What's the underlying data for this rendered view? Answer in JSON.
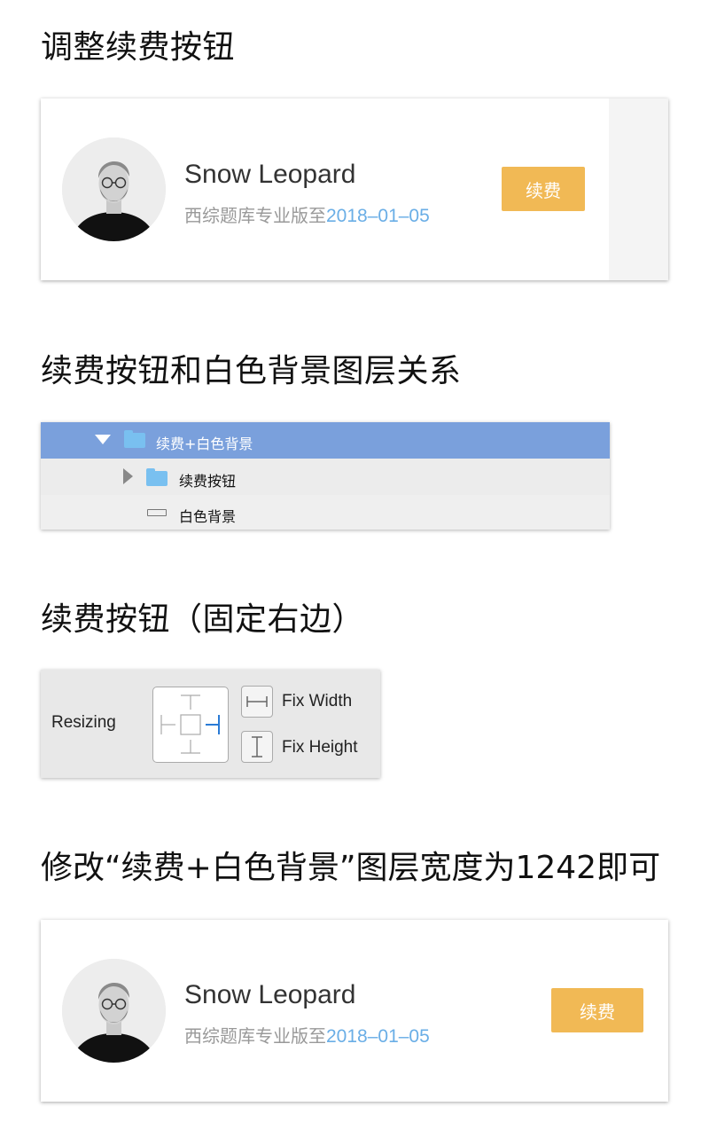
{
  "headings": {
    "h1": "调整续费按钮",
    "h2": "续费按钮和白色背景图层关系",
    "h3": "续费按钮（固定右边）",
    "h4": "修改“续费+白色背景”图层宽度为1242即可"
  },
  "card": {
    "name": "Snow Leopard",
    "subtitle_prefix": "西综题库专业版至",
    "date": "2018–01–05",
    "button": "续费"
  },
  "layers": {
    "items": [
      {
        "label": "续费+白色背景",
        "expanded": true,
        "selected": true,
        "kind": "folder"
      },
      {
        "label": "续费按钮",
        "expanded": false,
        "selected": false,
        "kind": "folder"
      },
      {
        "label": "白色背景",
        "selected": false,
        "kind": "rectangle"
      }
    ]
  },
  "resizing": {
    "label": "Resizing",
    "fix_width": "Fix Width",
    "fix_height": "Fix Height",
    "pinned_right": true
  },
  "colors": {
    "button": "#f1b955",
    "date": "#6aaee6",
    "selection": "#7aa0dc",
    "folder": "#79c0f0",
    "pin_active": "#2a7bd6"
  }
}
